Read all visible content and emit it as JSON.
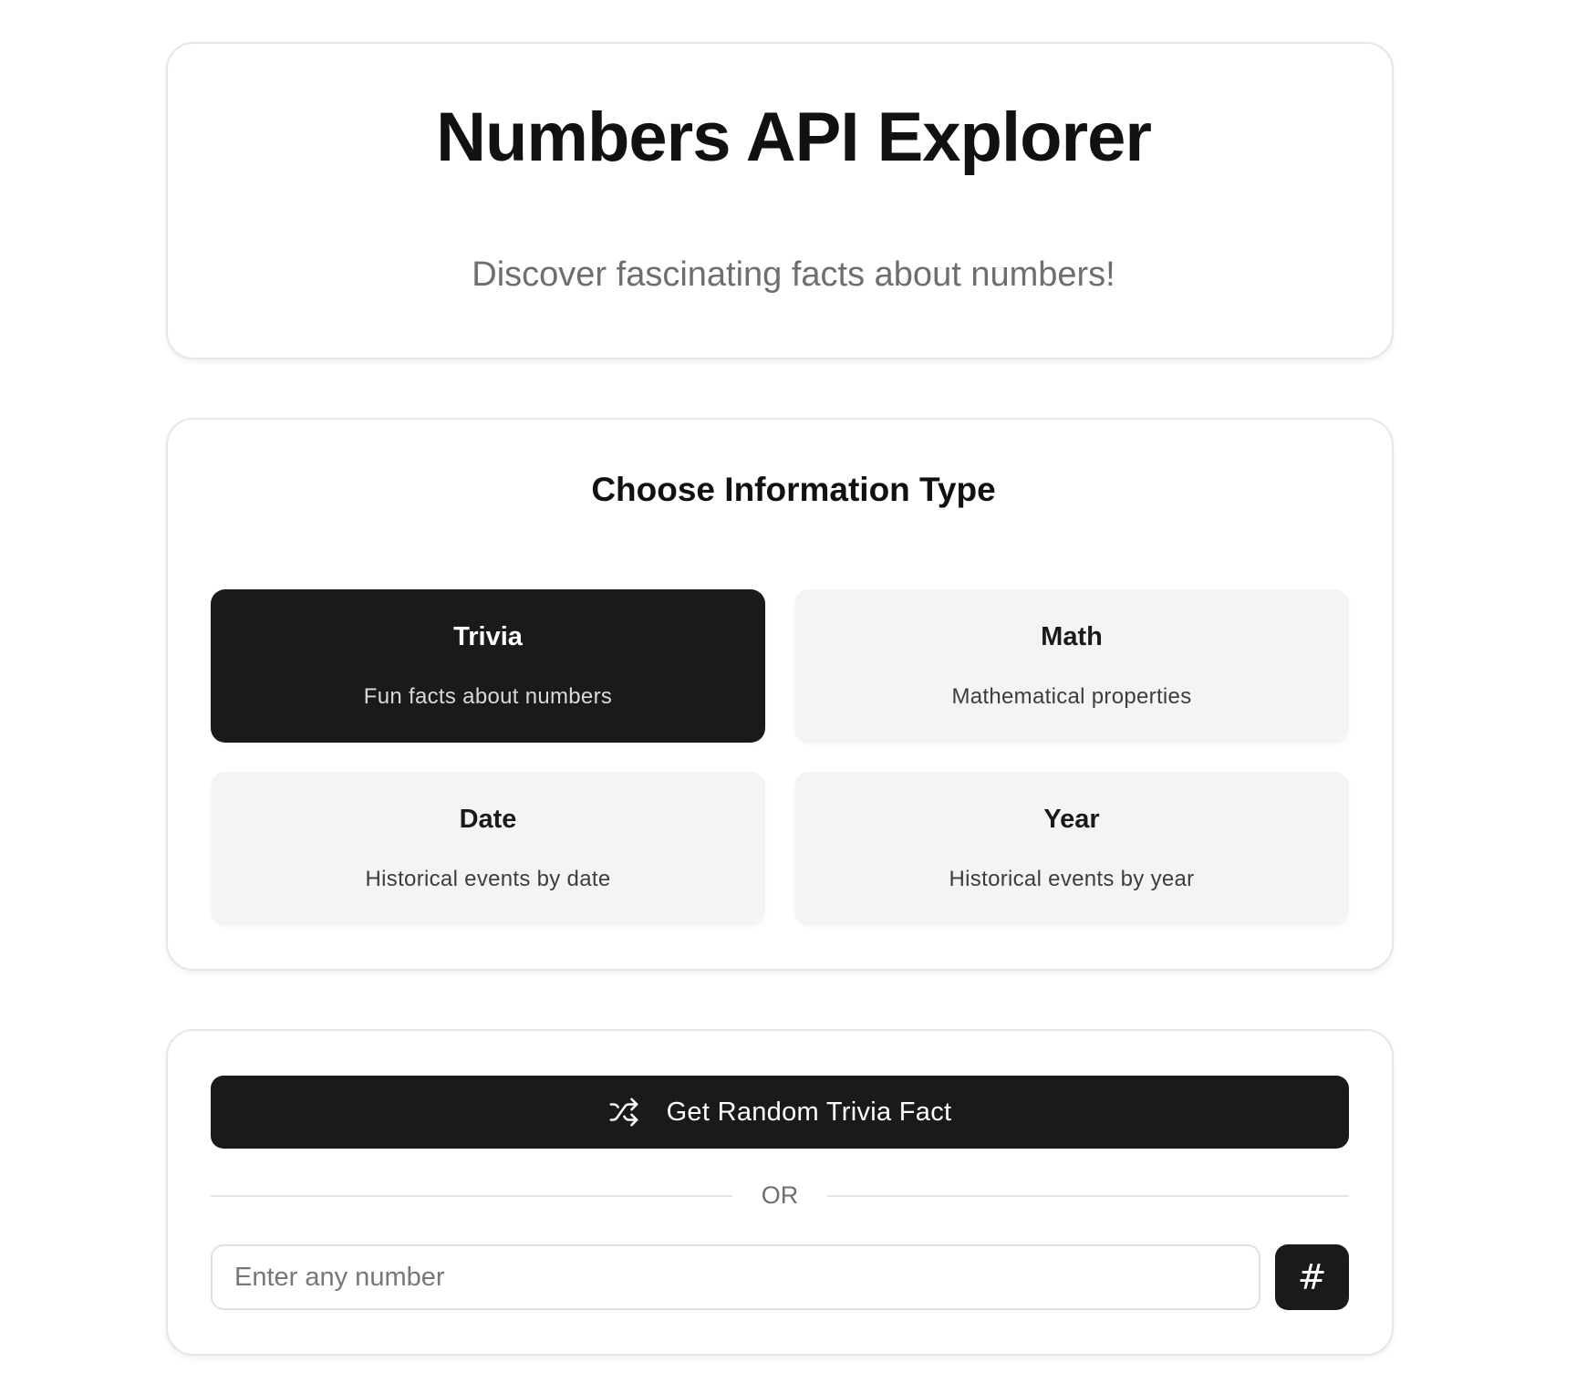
{
  "header": {
    "title": "Numbers API Explorer",
    "subtitle": "Discover fascinating facts about numbers!"
  },
  "types": {
    "heading": "Choose Information Type",
    "selected": "Trivia",
    "options": [
      {
        "title": "Trivia",
        "description": "Fun facts about numbers"
      },
      {
        "title": "Math",
        "description": "Mathematical properties"
      },
      {
        "title": "Date",
        "description": "Historical events by date"
      },
      {
        "title": "Year",
        "description": "Historical events by year"
      }
    ]
  },
  "actions": {
    "random_button_label": "Get Random Trivia Fact",
    "random_button_icon": "shuffle-icon",
    "divider_text": "OR",
    "number_input_placeholder": "Enter any number",
    "number_input_value": "",
    "submit_button_symbol": "#",
    "submit_button_icon": "hash-icon"
  },
  "colors": {
    "accent": "#1a1a1a",
    "option_bg": "#f4f4f4",
    "muted_text": "#6e6e6e"
  }
}
